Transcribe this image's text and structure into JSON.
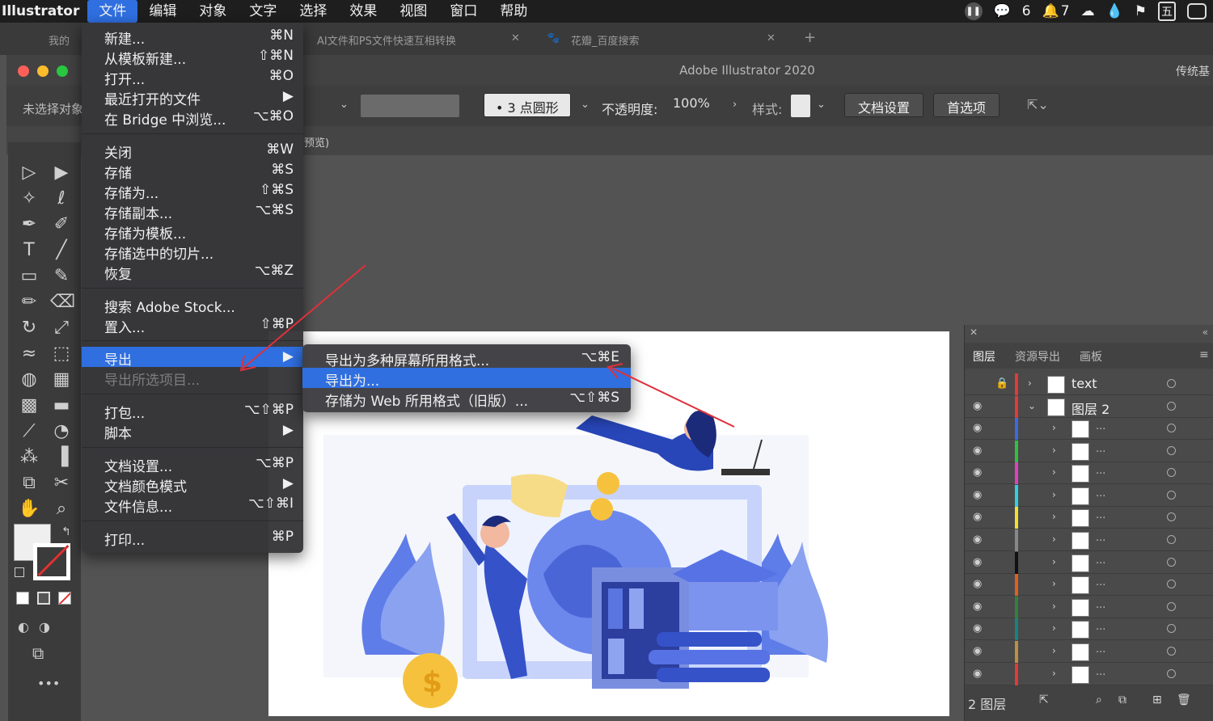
{
  "menubar": {
    "app": "Illustrator",
    "items": [
      "文件",
      "编辑",
      "对象",
      "文字",
      "选择",
      "效果",
      "视图",
      "窗口",
      "帮助"
    ],
    "wechat_count": "6",
    "notify_count": "7",
    "ime": "五"
  },
  "browser_tabs": {
    "tab1": "我的",
    "tab2": "AI文件和PS文件快速互相转换",
    "tab3": "花瓣_百度搜索"
  },
  "window": {
    "title": "Adobe Illustrator 2020",
    "workspace": "传统基",
    "no_selection": "未选择对象"
  },
  "controlbar": {
    "brush": "3 点圆形",
    "opacity_label": "不透明度:",
    "opacity_value": "100%",
    "style_label": "样式:",
    "doc_settings": "文档设置",
    "preferences": "首选项"
  },
  "docbar": {
    "tab_suffix": "预览)"
  },
  "file_menu": {
    "items": [
      {
        "label": "新建...",
        "shortcut": "⌘N"
      },
      {
        "label": "从模板新建...",
        "shortcut": "⇧⌘N"
      },
      {
        "label": "打开...",
        "shortcut": "⌘O"
      },
      {
        "label": "最近打开的文件",
        "shortcut": "▶"
      },
      {
        "label": "在 Bridge 中浏览...",
        "shortcut": "⌥⌘O"
      },
      {
        "label": "关闭",
        "shortcut": "⌘W"
      },
      {
        "label": "存储",
        "shortcut": "⌘S"
      },
      {
        "label": "存储为...",
        "shortcut": "⇧⌘S"
      },
      {
        "label": "存储副本...",
        "shortcut": "⌥⌘S"
      },
      {
        "label": "存储为模板...",
        "shortcut": ""
      },
      {
        "label": "存储选中的切片...",
        "shortcut": ""
      },
      {
        "label": "恢复",
        "shortcut": "⌥⌘Z"
      },
      {
        "label": "搜索 Adobe Stock...",
        "shortcut": ""
      },
      {
        "label": "置入...",
        "shortcut": "⇧⌘P"
      },
      {
        "label": "导出",
        "shortcut": "▶"
      },
      {
        "label": "导出所选项目...",
        "shortcut": ""
      },
      {
        "label": "打包...",
        "shortcut": "⌥⇧⌘P"
      },
      {
        "label": "脚本",
        "shortcut": "▶"
      },
      {
        "label": "文档设置...",
        "shortcut": "⌥⌘P"
      },
      {
        "label": "文档颜色模式",
        "shortcut": "▶"
      },
      {
        "label": "文件信息...",
        "shortcut": "⌥⇧⌘I"
      },
      {
        "label": "打印...",
        "shortcut": "⌘P"
      }
    ]
  },
  "export_submenu": {
    "items": [
      {
        "label": "导出为多种屏幕所用格式...",
        "shortcut": "⌥⌘E"
      },
      {
        "label": "导出为...",
        "shortcut": ""
      },
      {
        "label": "存储为 Web 所用格式（旧版）...",
        "shortcut": "⌥⇧⌘S"
      }
    ]
  },
  "layers_panel": {
    "tabs": [
      "图层",
      "资源导出",
      "画板"
    ],
    "layer_text": "text",
    "layer_2": "图层 2",
    "sublayer_label": "...",
    "footer": "2 图层",
    "colors": {
      "text": "#e03a3a",
      "layer2": "#e03a3a",
      "subs": [
        "#3a6be0",
        "#30c040",
        "#e040c0",
        "#30d0e0",
        "#f0e030",
        "#888888",
        "#111111",
        "#e06020",
        "#308040",
        "#1a8080",
        "#c09040",
        "#e03a3a"
      ]
    }
  },
  "accent": "#2f6fe0"
}
